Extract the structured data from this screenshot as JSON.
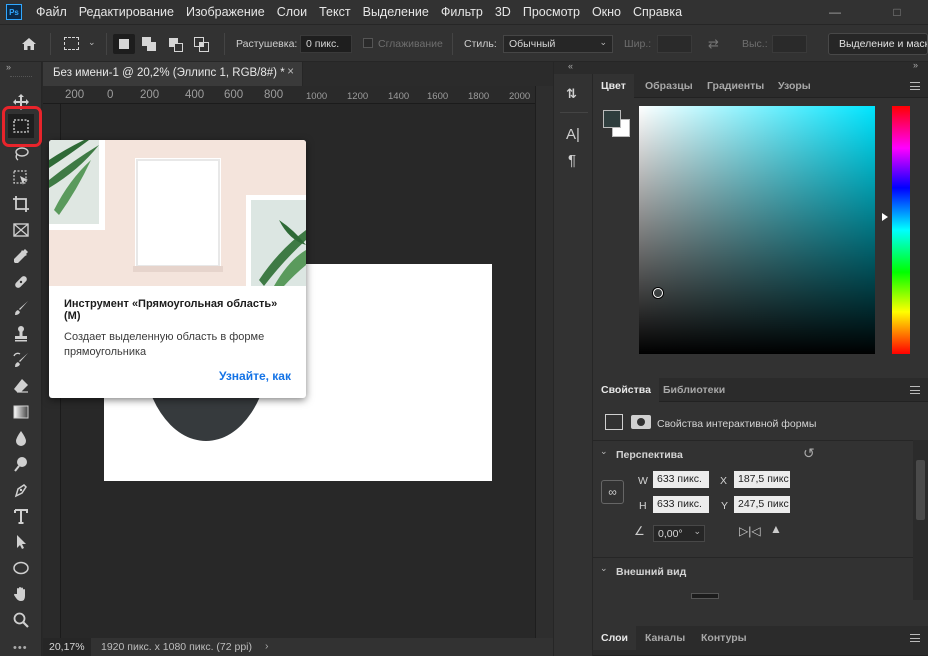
{
  "menubar": {
    "logo": "Ps",
    "items": [
      "Файл",
      "Редактирование",
      "Изображение",
      "Слои",
      "Текст",
      "Выделение",
      "Фильтр",
      "3D",
      "Просмотр",
      "Окно",
      "Справка"
    ]
  },
  "options": {
    "feather_label": "Растушевка:",
    "feather_value": "0 пикс.",
    "antialias_label": "Сглаживание",
    "style_label": "Стиль:",
    "style_value": "Обычный",
    "width_label": "Шир.:",
    "height_label": "Выс.:",
    "select_mask_button": "Выделение и маск"
  },
  "document": {
    "tab_title": "Без имени-1 @ 20,2% (Эллипс 1, RGB/8#) *",
    "ruler_ticks": [
      "200",
      "0",
      "200",
      "400",
      "600",
      "800",
      "1000",
      "1200",
      "1400",
      "1600",
      "1800",
      "2000"
    ],
    "zoom": "20,17%",
    "info": "1920 пикс. x 1080 пикс. (72 ppi)"
  },
  "tooltip": {
    "title": "Инструмент «Прямоугольная область» (M)",
    "description": "Создает выделенную область в форме прямоугольника",
    "link": "Узнайте, как"
  },
  "color_panel": {
    "tabs": [
      "Цвет",
      "Образцы",
      "Градиенты",
      "Узоры"
    ],
    "foreground": "#2f3e3e",
    "background": "#ffffff"
  },
  "properties_panel": {
    "tabs": [
      "Свойства",
      "Библиотеки"
    ],
    "kind_label": "Свойства интерактивной формы",
    "perspective_label": "Перспектива",
    "w_label": "W",
    "w_value": "633 пикс.",
    "x_label": "X",
    "x_value": "187,5 пикс",
    "h_label": "H",
    "h_value": "633 пикс.",
    "y_label": "Y",
    "y_value": "247,5 пикс",
    "angle_value": "0,00°",
    "appearance_label": "Внешний вид"
  },
  "layers_panel": {
    "tabs": [
      "Слои",
      "Каналы",
      "Контуры"
    ]
  },
  "icons": {
    "home": "home-icon",
    "marquee": "rectangular-marquee-icon"
  }
}
